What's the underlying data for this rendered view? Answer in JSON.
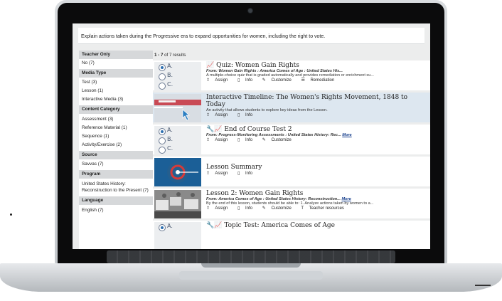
{
  "prompt": "Explain actions taken during the Progressive era to expand opportunities for women, including the right to vote.",
  "filters": [
    {
      "heading": "Teacher Only",
      "items": [
        "No (7)"
      ]
    },
    {
      "heading": "Media Type",
      "items": [
        "Test (3)",
        "Lesson (1)",
        "Interactive Media (3)"
      ]
    },
    {
      "heading": "Content Category",
      "items": [
        "Assessment (3)",
        "Reference Material (1)",
        "Sequence (1)",
        "Activity/Exercise (2)"
      ]
    },
    {
      "heading": "Source",
      "items": [
        "Savvas (7)"
      ]
    },
    {
      "heading": "Program",
      "items": [
        "United States History: Reconstruction to the Present (7)"
      ]
    },
    {
      "heading": "Language",
      "items": [
        "English (7)"
      ]
    }
  ],
  "results_count": {
    "range": "1 - 7",
    "suffix": " of 7 results"
  },
  "results": [
    {
      "title": "Quiz: Women Gain Rights",
      "from": "From: Women Gain Rights : America Comes of Age : United States His...",
      "desc": "A multiple-choice quiz that is graded automatically and provides remediation or enrichment su...",
      "actions": [
        "Assign",
        "Info",
        "Customize",
        "Remediation"
      ],
      "more": ""
    },
    {
      "title": "Interactive Timeline: The Women's Rights Movement, 1848 to Today",
      "from": "",
      "desc": "An activity that allows students to explore key ideas from the Lesson.",
      "actions": [
        "Assign",
        "Info"
      ],
      "more": ""
    },
    {
      "title": "End of Course Test 2",
      "from": "From: Progress-Monitoring Assessments : United States History: Rec...",
      "desc": "",
      "actions": [
        "Assign",
        "Info",
        "Customize"
      ],
      "more": "More"
    },
    {
      "title": "Lesson Summary",
      "from": "",
      "desc": "",
      "actions": [
        "Assign",
        "Info"
      ],
      "more": ""
    },
    {
      "title": "Lesson 2: Women Gain Rights",
      "from": "From: America Comes of Age : United States History: Reconstruction...",
      "desc": "By the end of this lesson, students should be able to: 1. Analyze actions taken by women to a...",
      "actions": [
        "Assign",
        "Info",
        "Customize",
        "Teacher resources"
      ],
      "more": "More"
    },
    {
      "title": "Topic Test: America Comes of Age",
      "from": "",
      "desc": "",
      "actions": [],
      "more": ""
    }
  ],
  "quiz_options": [
    "A.",
    "B.",
    "C."
  ],
  "icons": {
    "chart": "chart-icon",
    "assign": "assign-icon",
    "info": "info-icon",
    "customize": "customize-icon",
    "remediation": "remediation-icon",
    "teacher": "teacher-resources-icon"
  },
  "colors": {
    "highlight": "#dde7f0",
    "link": "#123b8a",
    "filter_header": "#d6d8da"
  }
}
